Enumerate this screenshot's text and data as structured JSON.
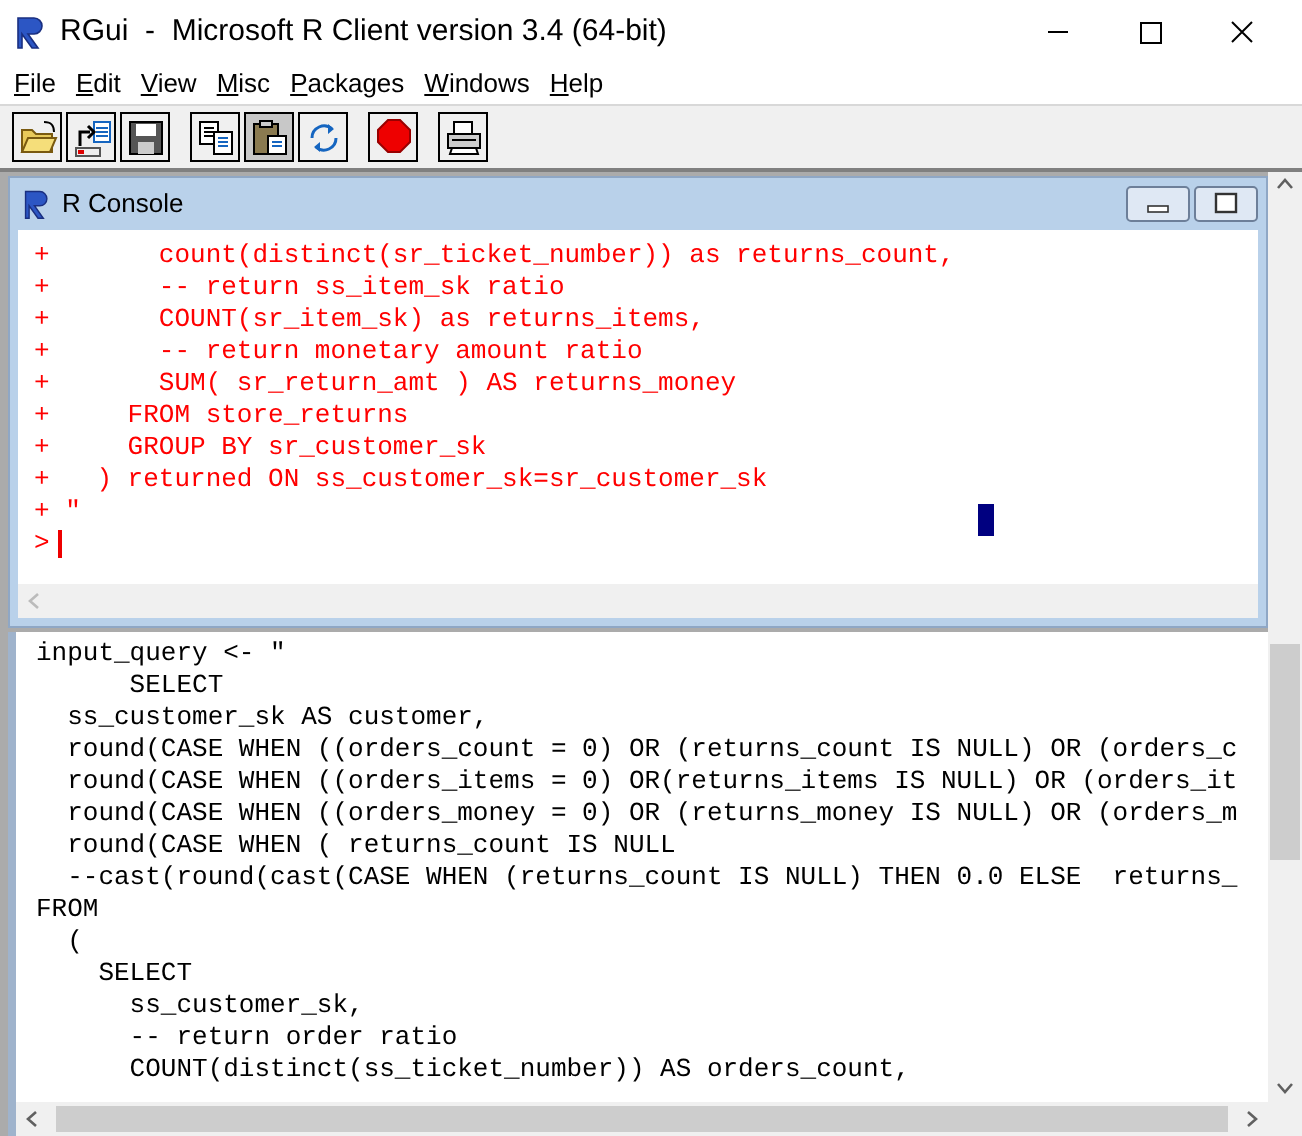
{
  "window": {
    "title": "RGui  -  Microsoft R Client version 3.4 (64-bit)"
  },
  "menu": [
    {
      "label": "File"
    },
    {
      "label": "Edit"
    },
    {
      "label": "View"
    },
    {
      "label": "Misc"
    },
    {
      "label": "Packages"
    },
    {
      "label": "Windows"
    },
    {
      "label": "Help"
    }
  ],
  "toolbar": [
    {
      "kind": "open"
    },
    {
      "kind": "load"
    },
    {
      "kind": "save"
    },
    {
      "kind": "copy"
    },
    {
      "kind": "paste"
    },
    {
      "kind": "copypaste"
    },
    {
      "kind": "stop"
    },
    {
      "kind": "print"
    }
  ],
  "console": {
    "title": "R Console",
    "lines": [
      "+       count(distinct(sr_ticket_number)) as returns_count,",
      "+       -- return ss_item_sk ratio",
      "+       COUNT(sr_item_sk) as returns_items,",
      "+       -- return monetary amount ratio",
      "+       SUM( sr_return_amt ) AS returns_money",
      "+     FROM store_returns",
      "+     GROUP BY sr_customer_sk",
      "+   ) returned ON ss_customer_sk=sr_customer_sk",
      "+ \""
    ],
    "prompt": ">"
  },
  "editor": {
    "lines": [
      "input_query <- \"",
      "      SELECT",
      "  ss_customer_sk AS customer,",
      "  round(CASE WHEN ((orders_count = 0) OR (returns_count IS NULL) OR (orders_c",
      "  round(CASE WHEN ((orders_items = 0) OR(returns_items IS NULL) OR (orders_it",
      "  round(CASE WHEN ((orders_money = 0) OR (returns_money IS NULL) OR (orders_m",
      "  round(CASE WHEN ( returns_count IS NULL",
      "  --cast(round(cast(CASE WHEN (returns_count IS NULL) THEN 0.0 ELSE  returns_",
      "FROM",
      "  (",
      "    SELECT",
      "      ss_customer_sk,",
      "      -- return order ratio",
      "      COUNT(distinct(ss_ticket_number)) AS orders_count,"
    ]
  }
}
